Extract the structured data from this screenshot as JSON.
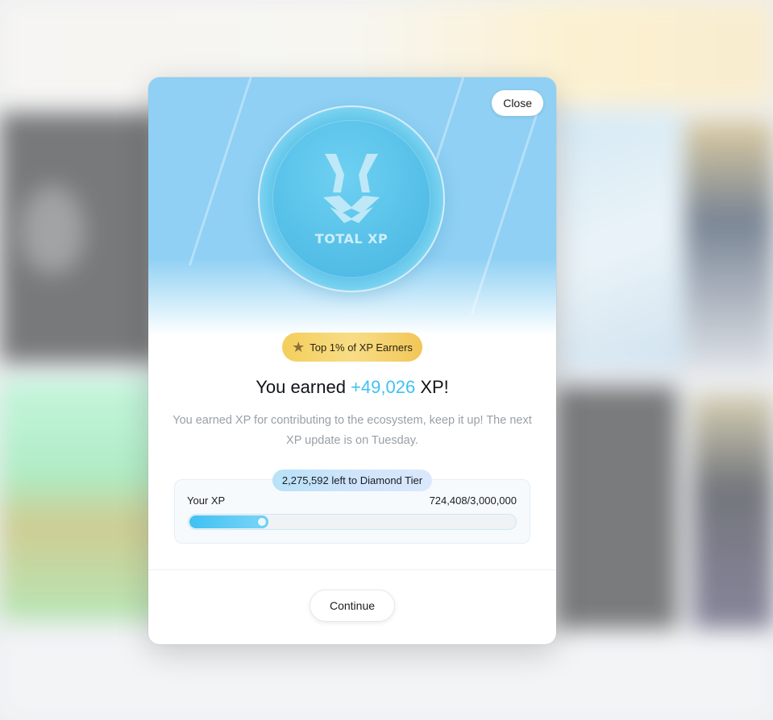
{
  "modal": {
    "close_label": "Close",
    "coin_label": "TOTAL XP",
    "badge_text": "Top 1% of XP Earners",
    "headline_prefix": "You earned ",
    "xp_gained": "+49,026",
    "headline_suffix": " XP!",
    "description": "You earned XP for contributing to the ecosystem, keep it up! The next XP update is on Tuesday.",
    "tier_remaining": "2,275,592 left to Diamond Tier",
    "progress_label": "Your XP",
    "progress_value": "724,408/3,000,000",
    "progress_fraction": 0.2415,
    "continue_label": "Continue"
  },
  "colors": {
    "accent": "#3fc1f3",
    "hero_bg": "#8fd0f4",
    "badge_gold": "#f4ce5c"
  },
  "icons": {
    "coin_logo": "tri-chevron-logo-icon",
    "badge_icon": "star-icon"
  }
}
